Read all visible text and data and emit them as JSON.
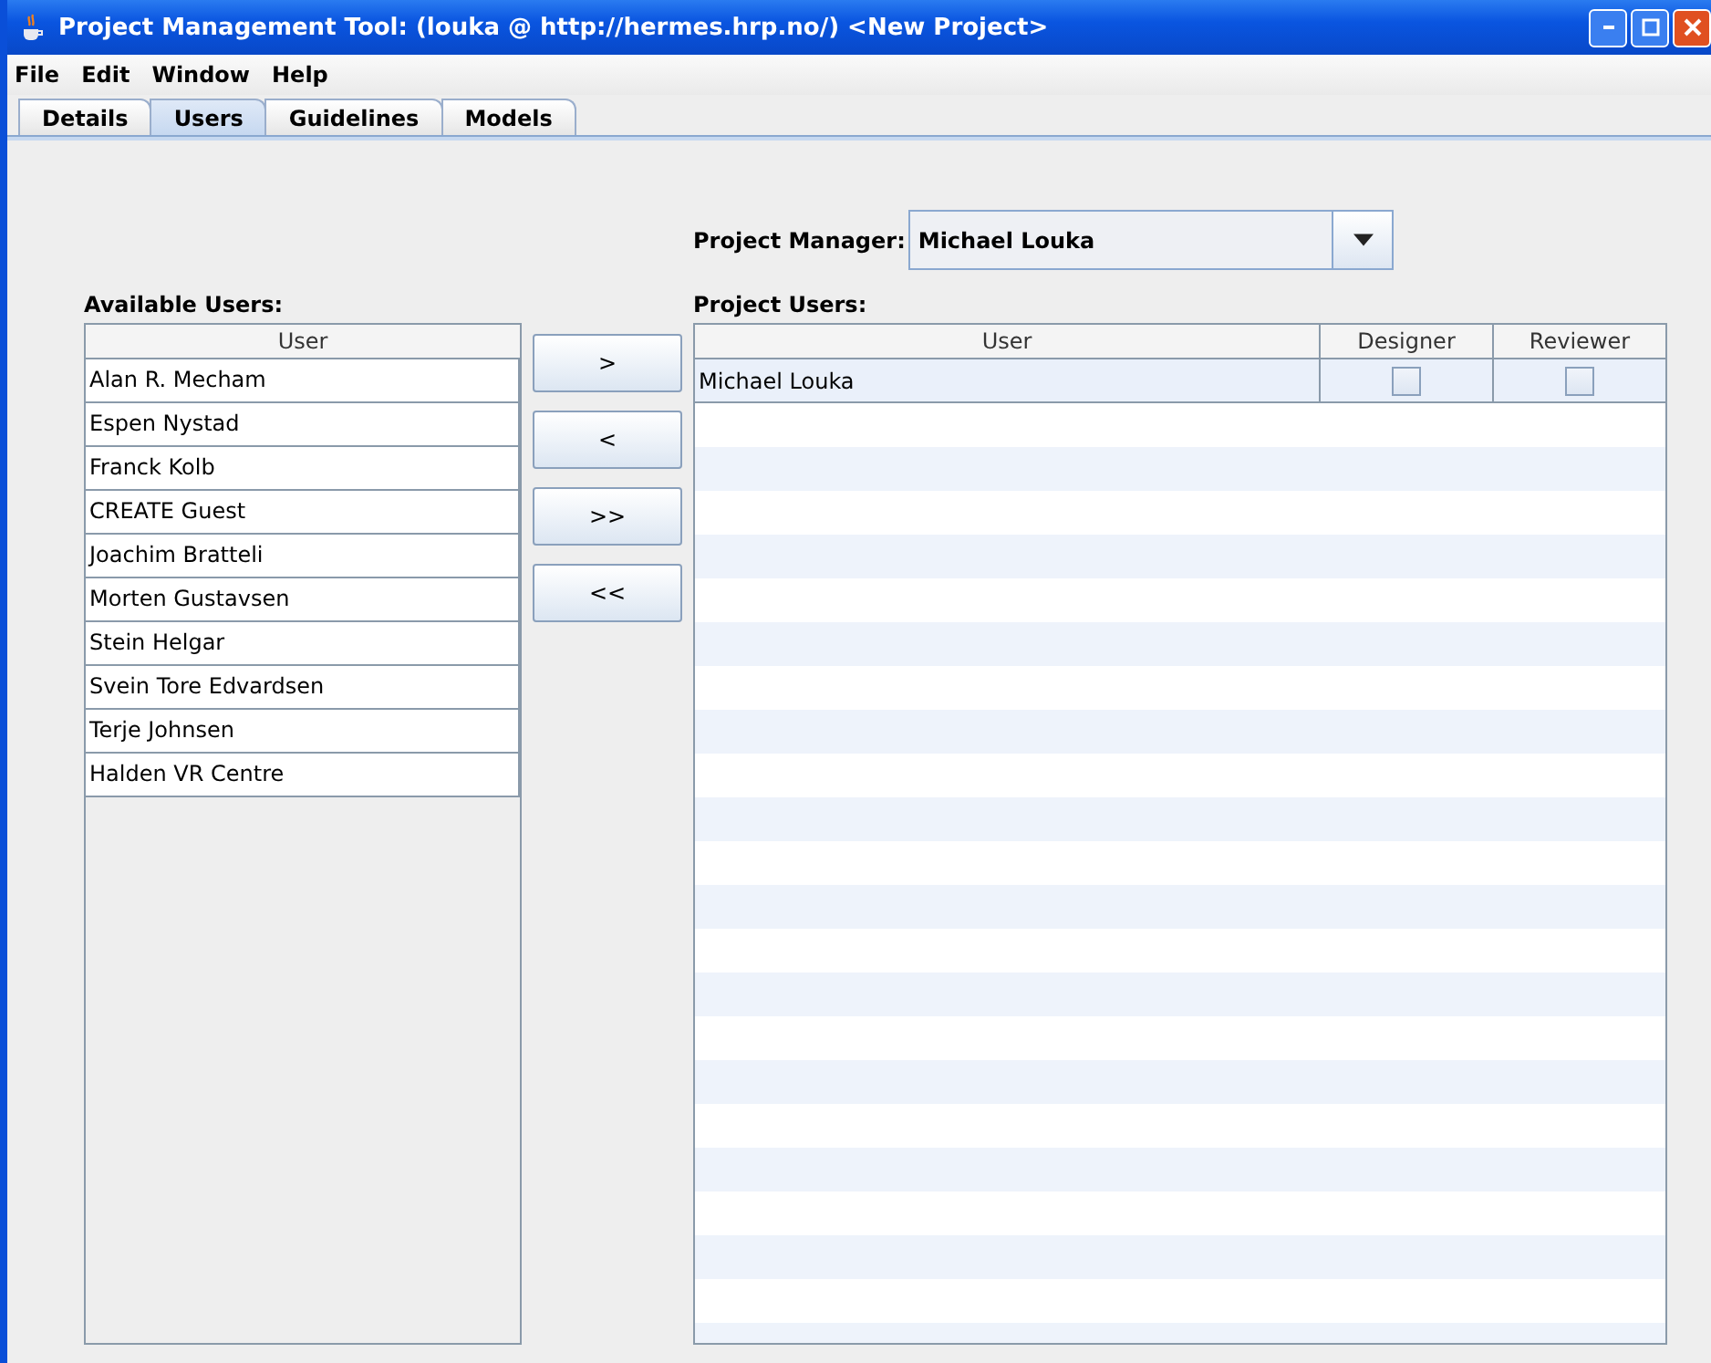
{
  "window": {
    "title": "Project Management Tool: (louka @ http://hermes.hrp.no/) <New Project>"
  },
  "menu": [
    "File",
    "Edit",
    "Window",
    "Help"
  ],
  "tabs": [
    {
      "label": "Details",
      "selected": false
    },
    {
      "label": "Users",
      "selected": true
    },
    {
      "label": "Guidelines",
      "selected": false
    },
    {
      "label": "Models",
      "selected": false
    }
  ],
  "project_manager": {
    "label": "Project Manager:",
    "value": "Michael Louka"
  },
  "available_users": {
    "label": "Available Users:",
    "column": "User",
    "rows": [
      "Alan R. Mecham",
      "Espen Nystad",
      "Franck Kolb",
      "CREATE Guest",
      "Joachim Bratteli",
      "Morten Gustavsen",
      "Stein Helgar",
      "Svein Tore Edvardsen",
      "Terje Johnsen",
      "Halden VR Centre"
    ]
  },
  "transfer_buttons": [
    ">",
    "<",
    ">>",
    "<<"
  ],
  "project_users": {
    "label": "Project Users:",
    "columns": [
      "User",
      "Designer",
      "Reviewer"
    ],
    "rows": [
      {
        "user": "Michael Louka",
        "designer": false,
        "reviewer": false
      }
    ]
  }
}
